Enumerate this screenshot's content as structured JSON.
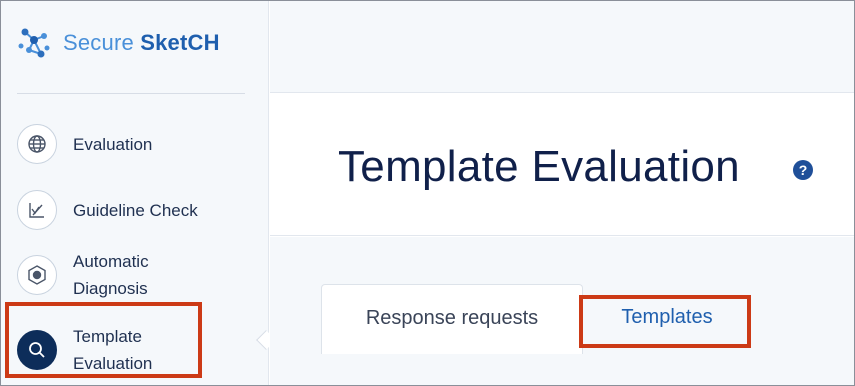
{
  "brand": {
    "secure": "Secure",
    "sketch": "SketCH"
  },
  "nav": [
    {
      "label": "Evaluation",
      "icon": "globe-icon"
    },
    {
      "label": "Guideline Check",
      "icon": "chart-check-icon"
    },
    {
      "label": "Automatic Diagnosis",
      "icon": "gear-hex-icon"
    },
    {
      "label": "Template Evaluation",
      "icon": "search-icon",
      "active": true
    }
  ],
  "page": {
    "title": "Template Evaluation",
    "help_glyph": "?"
  },
  "tabs": [
    {
      "label": "Response requests",
      "active": true
    },
    {
      "label": "Templates",
      "active": false
    }
  ],
  "colors": {
    "accent": "#1f5fae",
    "highlight": "#cc3a16",
    "active_icon_bg": "#0d2d5a"
  }
}
